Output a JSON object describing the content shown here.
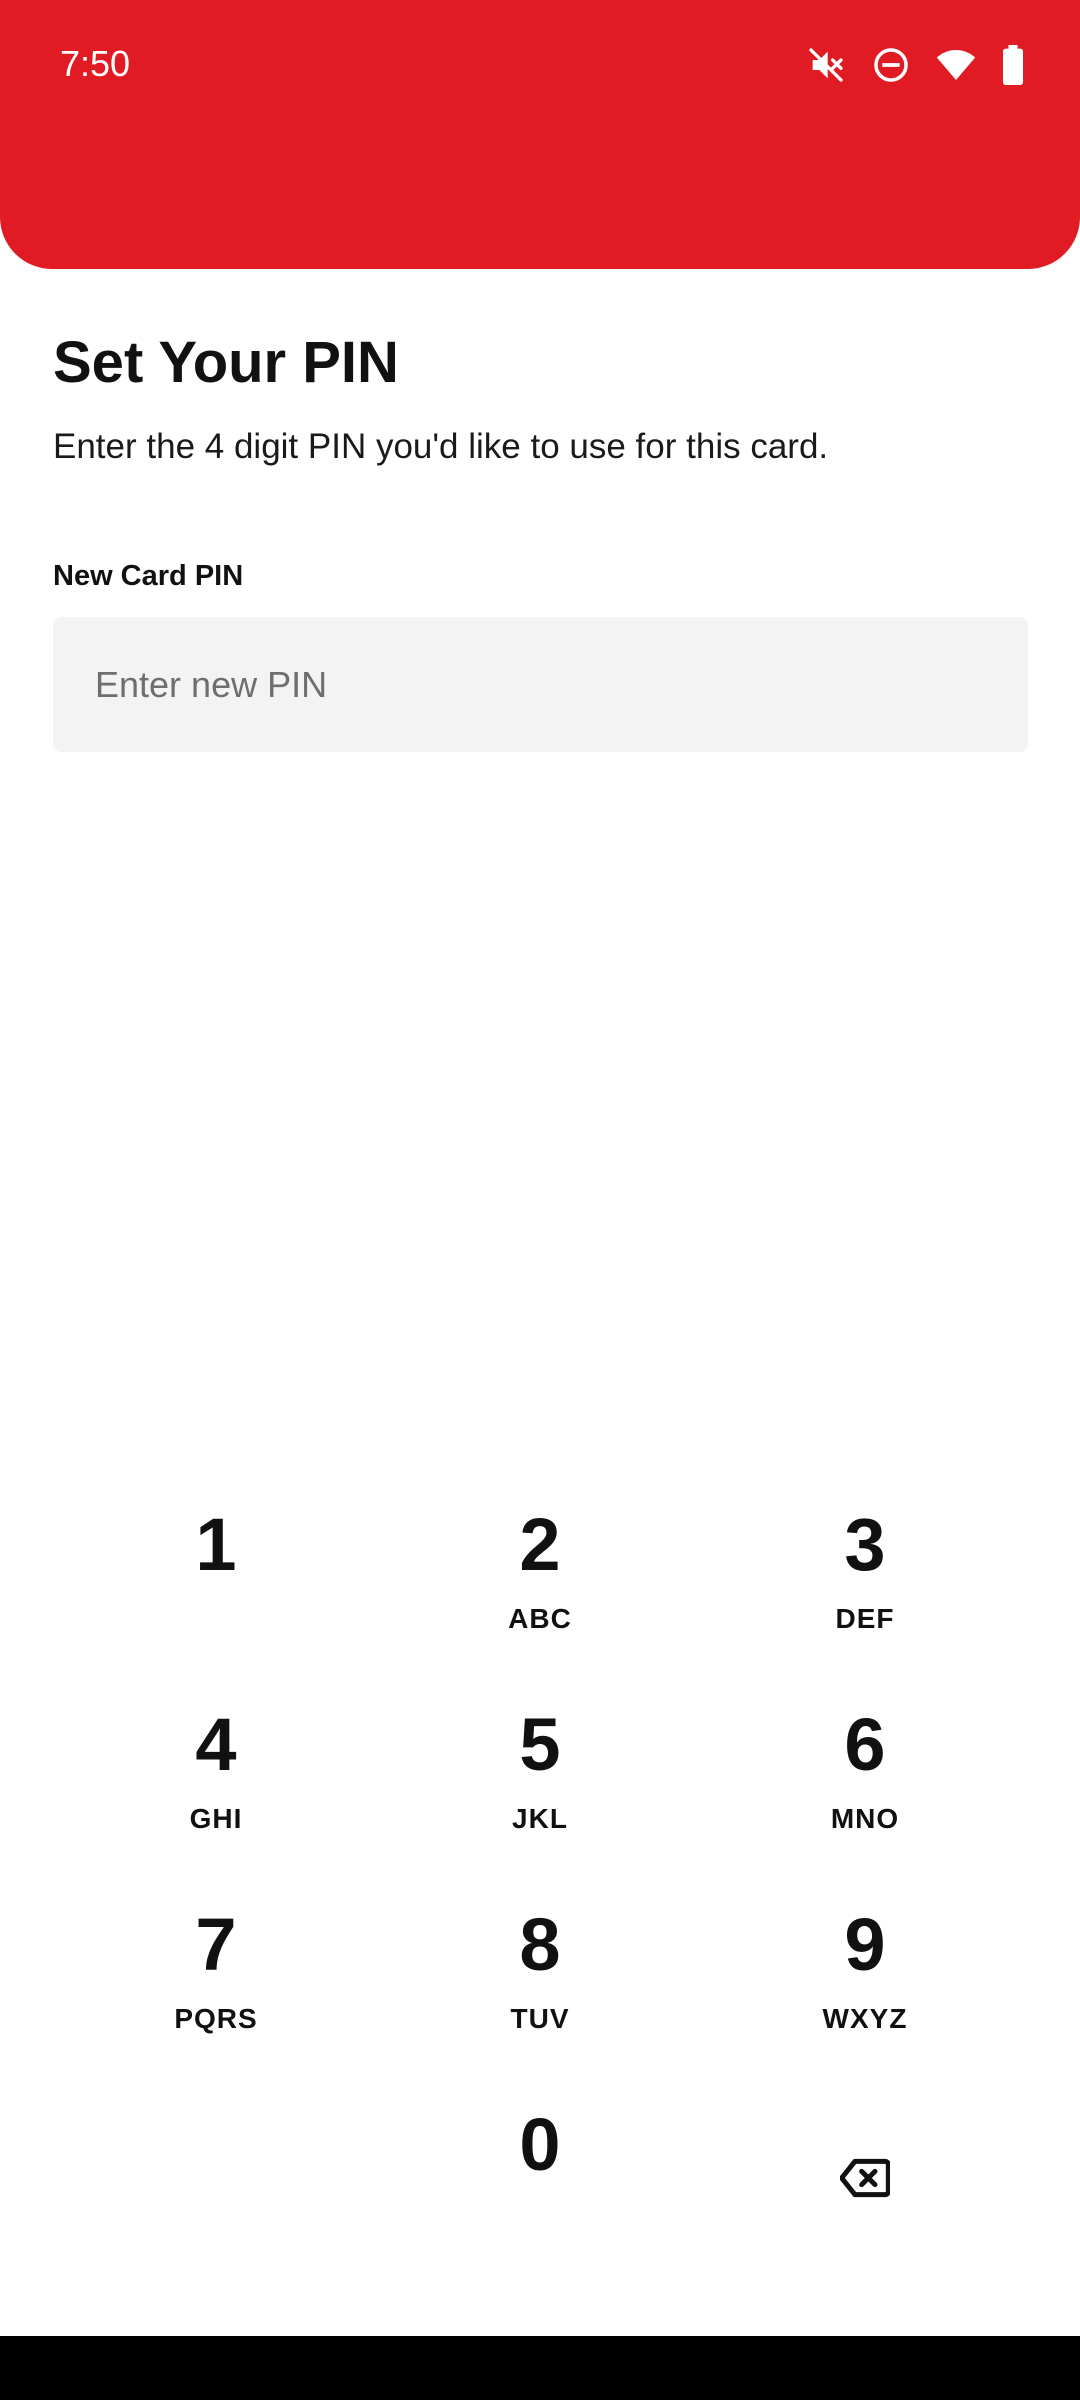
{
  "status_bar": {
    "time": "7:50",
    "icons": [
      "mute-icon",
      "do-not-disturb-icon",
      "wifi-icon",
      "battery-icon"
    ]
  },
  "colors": {
    "brand": "#E01B24",
    "input_bg": "#F3F3F3",
    "text": "#111111"
  },
  "page": {
    "title": "Set Your PIN",
    "subtitle": "Enter the 4 digit PIN you'd like to use for this card."
  },
  "form": {
    "pin_label": "New Card PIN",
    "pin_value": "",
    "pin_placeholder": "Enter new PIN"
  },
  "keypad": {
    "keys": [
      {
        "digit": "1",
        "letters": ""
      },
      {
        "digit": "2",
        "letters": "ABC"
      },
      {
        "digit": "3",
        "letters": "DEF"
      },
      {
        "digit": "4",
        "letters": "GHI"
      },
      {
        "digit": "5",
        "letters": "JKL"
      },
      {
        "digit": "6",
        "letters": "MNO"
      },
      {
        "digit": "7",
        "letters": "PQRS"
      },
      {
        "digit": "8",
        "letters": "TUV"
      },
      {
        "digit": "9",
        "letters": "WXYZ"
      },
      {
        "digit": "0",
        "letters": ""
      }
    ],
    "backspace_icon": "backspace-icon"
  }
}
